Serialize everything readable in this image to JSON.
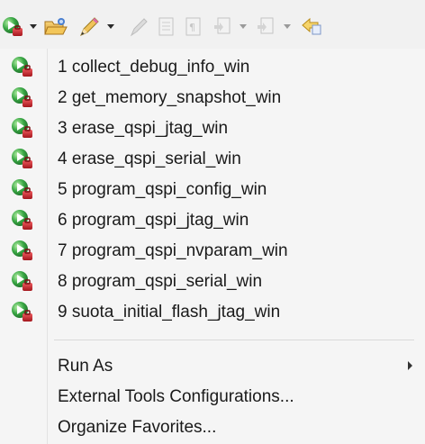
{
  "toolbar": {
    "items": [
      {
        "icon": "run-launch-icon"
      },
      {
        "icon": "dropdown-arrow-icon"
      },
      {
        "icon": "open-folder-icon"
      },
      {
        "icon": "pencil-icon"
      },
      {
        "icon": "dropdown-arrow-icon"
      },
      {
        "icon": "pencil-disabled-icon"
      },
      {
        "icon": "page-disabled-icon"
      },
      {
        "icon": "paragraph-disabled-icon"
      },
      {
        "icon": "next-annotation-disabled-icon"
      },
      {
        "icon": "dropdown-arrow-icon"
      },
      {
        "icon": "previous-annotation-disabled-icon"
      },
      {
        "icon": "dropdown-arrow-icon"
      },
      {
        "icon": "back-navigation-icon"
      }
    ]
  },
  "menu": {
    "favorites": [
      {
        "label": "1 collect_debug_info_win",
        "icon": "run-launch-config-icon"
      },
      {
        "label": "2 get_memory_snapshot_win",
        "icon": "run-launch-config-icon"
      },
      {
        "label": "3 erase_qspi_jtag_win",
        "icon": "run-launch-config-icon"
      },
      {
        "label": "4 erase_qspi_serial_win",
        "icon": "run-launch-config-icon"
      },
      {
        "label": "5 program_qspi_config_win",
        "icon": "run-launch-config-icon"
      },
      {
        "label": "6 program_qspi_jtag_win",
        "icon": "run-launch-config-icon"
      },
      {
        "label": "7 program_qspi_nvparam_win",
        "icon": "run-launch-config-icon"
      },
      {
        "label": "8 program_qspi_serial_win",
        "icon": "run-launch-config-icon"
      },
      {
        "label": "9 suota_initial_flash_jtag_win",
        "icon": "run-launch-config-icon"
      }
    ],
    "run_as": {
      "label": "Run As"
    },
    "external_tools_configurations": {
      "label": "External Tools Configurations..."
    },
    "organize_favorites": {
      "label": "Organize Favorites..."
    }
  },
  "colors": {
    "toolbar_background": "#f1f1f1",
    "menu_background": "#f5f5f5",
    "run_icon_green": "#2e9e3a",
    "toolbox_red": "#c8242b",
    "text": "#1a1a1a"
  }
}
